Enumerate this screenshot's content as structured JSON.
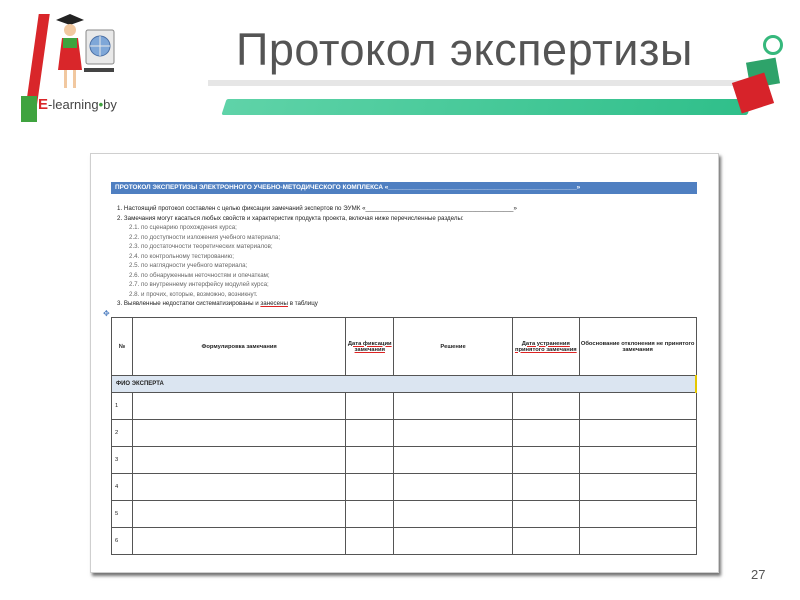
{
  "slide": {
    "title": "Протокол экспертизы",
    "page_number": "27",
    "logo_text": {
      "e": "E",
      "learning": "-learning",
      "dot": "•",
      "by": "by"
    }
  },
  "document": {
    "header": "ПРОТОКОЛ ЭКСПЕРТИЗЫ ЭЛЕКТРОННОГО УЧЕБНО-МЕТОДИЧЕСКОГО КОМПЛЕКСА «_____________________________________________________»",
    "list": [
      {
        "num": "1.",
        "text": "Настоящий протокол составлен с целью фиксации замечаний экспертов по ЭУМК «___________________________________________»"
      },
      {
        "num": "2.",
        "text": "Замечания могут касаться любых свойств и характеристик продукта проекта, включая ниже перечисленные разделы:"
      }
    ],
    "sublist": [
      "2.1. по сценарию прохождения курса;",
      "2.2. по доступности изложения учебного материала;",
      "2.3. по достаточности теоретических материалов;",
      "2.4. по контрольному тестированию;",
      "2.5. по наглядности учебного материала;",
      "2.6. по обнаруженным неточностям и опечаткам;",
      "2.7. по внутреннему интерфейсу модулей курса;",
      "2.8. и прочих, которые, возможно, возникнут."
    ],
    "item3": {
      "num": "3.",
      "pre": "Выявленные недостатки систематизированы и ",
      "underlined": "занесены",
      "post": " в таблицу"
    },
    "table": {
      "headers": [
        "№",
        "Формулировка замечания",
        "Дата фиксации замечания",
        "Решение",
        "Дата устранения принятого замечания",
        "Обоснование отклонения не принятого замечания"
      ],
      "expert_label": "ФИО ЭКСПЕРТА",
      "row_numbers": [
        "1",
        "2",
        "3",
        "4",
        "5",
        "6"
      ]
    }
  }
}
